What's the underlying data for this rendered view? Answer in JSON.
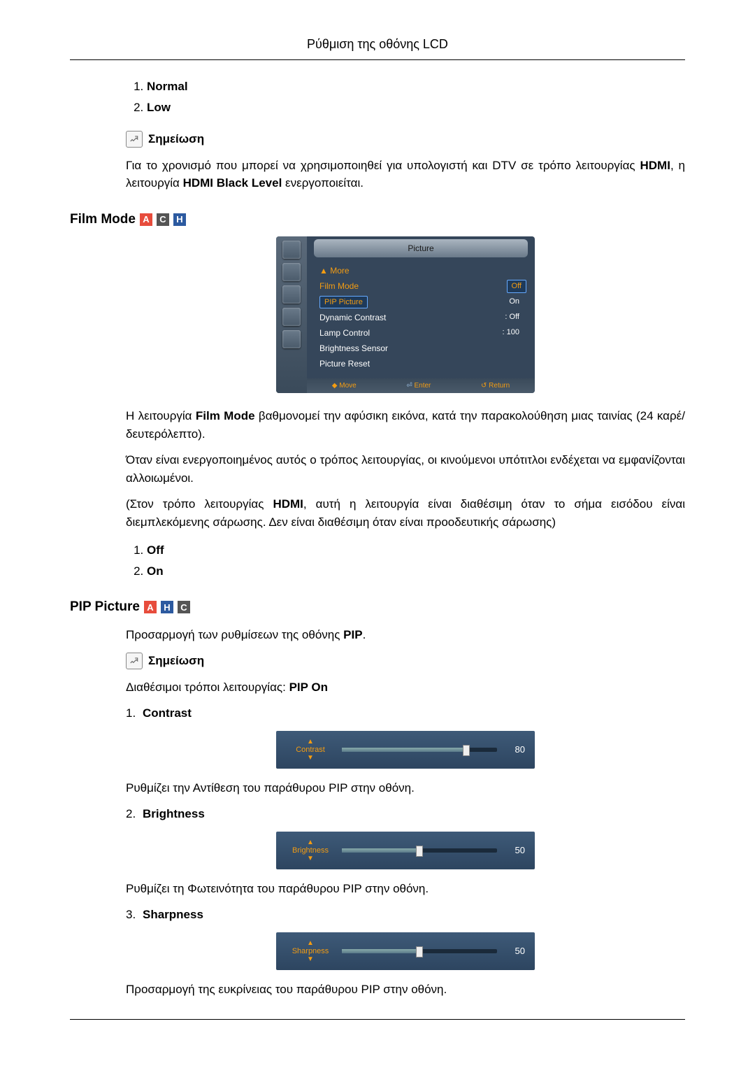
{
  "header": {
    "title": "Ρύθμιση της οθόνης LCD"
  },
  "section_hdmi": {
    "list": [
      "Normal",
      "Low"
    ],
    "note_label": "Σημείωση",
    "note_text_a": "Για το χρονισμό που μπορεί να χρησιμοποιηθεί για υπολογιστή και DTV σε τρόπο λειτουργίας ",
    "note_text_b": "HDMI",
    "note_text_c": ", η λειτουργία ",
    "note_text_d": "HDMI Black Level",
    "note_text_e": " ενεργοποιείται."
  },
  "film_mode": {
    "title": "Film Mode",
    "badges": [
      "A",
      "C",
      "H"
    ],
    "osd": {
      "panel_title": "Picture",
      "more": "More",
      "items": [
        {
          "label": "Film Mode",
          "value": "Off",
          "hl_v": true,
          "orange": true
        },
        {
          "label": "PIP Picture",
          "value": "On",
          "orange": true,
          "hl_l": true
        },
        {
          "label": "Dynamic Contrast",
          "value": ": Off"
        },
        {
          "label": "Lamp Control",
          "value": ": 100"
        },
        {
          "label": "Brightness Sensor",
          "value": ""
        },
        {
          "label": "Picture Reset",
          "value": ""
        }
      ],
      "footer": [
        "Move",
        "Enter",
        "Return"
      ]
    },
    "p1_a": "Η λειτουργία ",
    "p1_b": "Film Mode",
    "p1_c": " βαθμονομεί την αφύσικη εικόνα, κατά την παρακολούθηση μιας ταινίας (24 καρέ/δευτερόλεπτο).",
    "p2": "Όταν είναι ενεργοποιημένος αυτός ο τρόπος λειτουργίας, οι κινούμενοι υπότιτλοι ενδέχεται να εμφανίζονται αλλοιωμένοι.",
    "p3_a": "(Στον τρόπο λειτουργίας ",
    "p3_b": "HDMI",
    "p3_c": ", αυτή η λειτουργία είναι διαθέσιμη όταν το σήμα εισόδου είναι διεμπλεκόμενης σάρωσης. Δεν είναι διαθέσιμη όταν είναι προοδευτικής σάρωσης)",
    "list": [
      "Off",
      "On"
    ]
  },
  "pip_picture": {
    "title": "PIP Picture",
    "badges": [
      "A",
      "H",
      "C"
    ],
    "intro_a": "Προσαρμογή των ρυθμίσεων της οθόνης ",
    "intro_b": "PIP",
    "intro_c": ".",
    "note_label": "Σημείωση",
    "modes_a": "Διαθέσιμοι τρόποι λειτουργίας: ",
    "modes_b": "PIP On",
    "items": [
      {
        "n": "1.",
        "name": "Contrast",
        "value": 80,
        "desc": "Ρυθμίζει την Αντίθεση του παράθυρου PIP στην οθόνη.",
        "label": "Contrast"
      },
      {
        "n": "2.",
        "name": "Brightness",
        "value": 50,
        "desc": "Ρυθμίζει τη Φωτεινότητα του παράθυρου PIP στην οθόνη.",
        "label": "Brightness"
      },
      {
        "n": "3.",
        "name": "Sharpness",
        "value": 50,
        "desc": "Προσαρμογή της ευκρίνειας του παράθυρου PIP στην οθόνη.",
        "label": "Sharpness"
      }
    ]
  }
}
